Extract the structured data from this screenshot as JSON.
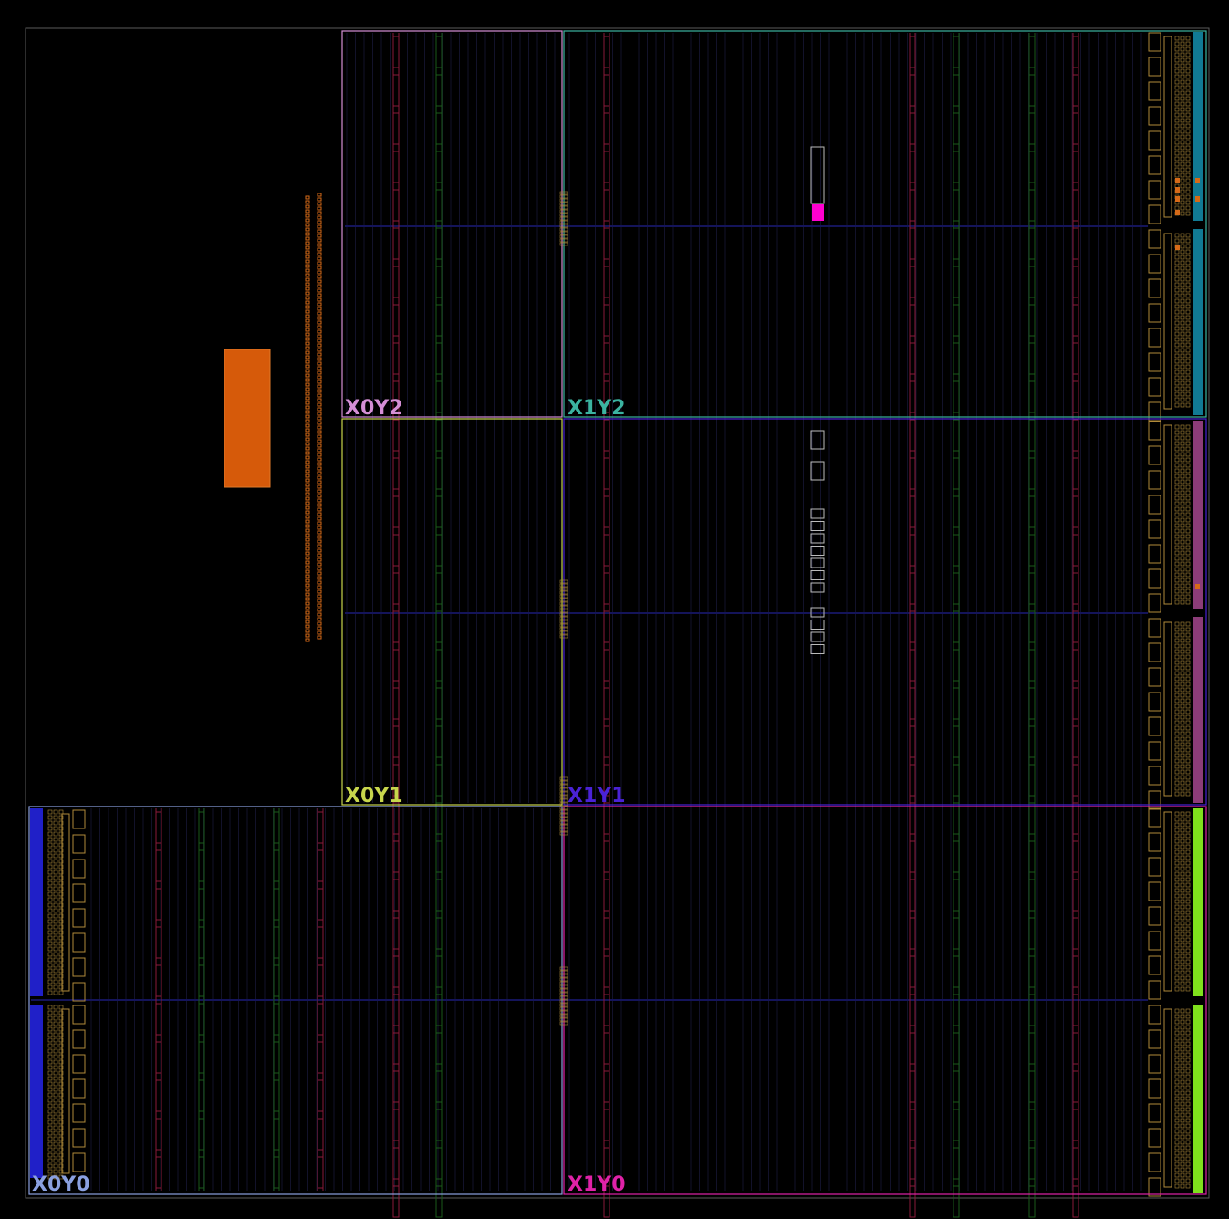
{
  "view": {
    "type": "fpga-device-floorplan",
    "background": "#000000",
    "outline_color": "#5a5a5a"
  },
  "clock_regions": [
    {
      "id": "X0Y2",
      "label": "X0Y2",
      "color": "#d58fd6"
    },
    {
      "id": "X1Y2",
      "label": "X1Y2",
      "color": "#3bb3a0"
    },
    {
      "id": "X0Y1",
      "label": "X0Y1",
      "color": "#c8d64c"
    },
    {
      "id": "X1Y1",
      "label": "X1Y1",
      "color": "#4a22d6"
    },
    {
      "id": "X0Y0",
      "label": "X0Y0",
      "color": "#8aa0e0"
    },
    {
      "id": "X1Y0",
      "label": "X1Y0",
      "color": "#e022a8"
    }
  ],
  "io_bank_colors": {
    "top": "#117a94",
    "middle": "#8c3c78",
    "bottom": "#7fe01c",
    "left": "#2020c8"
  },
  "site_colors": {
    "bram_column": "#8a1a3a",
    "dsp_column": "#1a5a1a",
    "clb_grid": "#12122a",
    "row_line": "#14145a",
    "io_tile": "#b08a3a",
    "placed_cell": "#ff00d0",
    "large_block": "#d65a0a",
    "cell_column": "#d66a18",
    "pblock_outline": "#bbbbbb"
  },
  "placed_cells": {
    "highlighted": 1,
    "outlined": 13
  }
}
